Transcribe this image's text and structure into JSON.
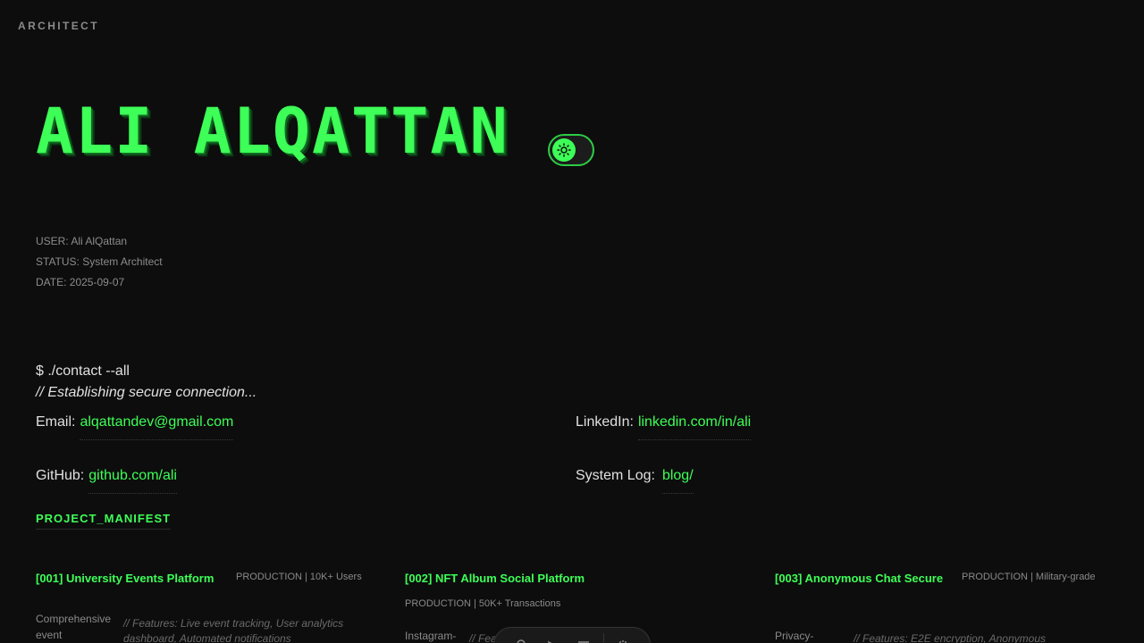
{
  "brand": "ARCHITECT",
  "hero": {
    "name": "ALI ALQATTAN"
  },
  "meta": {
    "user": "USER: Ali AlQattan",
    "status": "STATUS: System Architect",
    "date": "DATE: 2025-09-07"
  },
  "terminal": {
    "command": "$ ./contact --all",
    "comment": "// Establishing secure connection..."
  },
  "contacts": {
    "email": {
      "label": "Email:",
      "value": "alqattandev@gmail.com"
    },
    "linkedin": {
      "label": "LinkedIn:",
      "value": "linkedin.com/in/ali"
    },
    "github": {
      "label": "GitHub:",
      "value": "github.com/ali"
    },
    "blog": {
      "label": "System Log:",
      "value": "blog/"
    }
  },
  "manifest_title": "PROJECT_MANIFEST",
  "projects": [
    {
      "title": "[001] University Events Platform",
      "status": "PRODUCTION | 10K+ Users",
      "desc": "Comprehensive event",
      "features": "// Features: Live event tracking, User analytics dashboard, Automated notifications"
    },
    {
      "title": "[002] NFT Album Social Platform",
      "status": "PRODUCTION | 50K+ Transactions",
      "desc": "Instagram-",
      "features": "// Fea                              galleries,"
    },
    {
      "title": "[003] Anonymous Chat Secure",
      "status": "PRODUCTION | Military-grade",
      "desc": "Privacy-",
      "features": "// Features: E2E encryption, Anonymous"
    }
  ],
  "colors": {
    "accent": "#3dff57",
    "background": "#0d0d0d",
    "muted": "#8a8a8a"
  },
  "dock_icons": [
    "terminal-icon",
    "pointer-icon",
    "menu-icon",
    "settings-icon"
  ]
}
